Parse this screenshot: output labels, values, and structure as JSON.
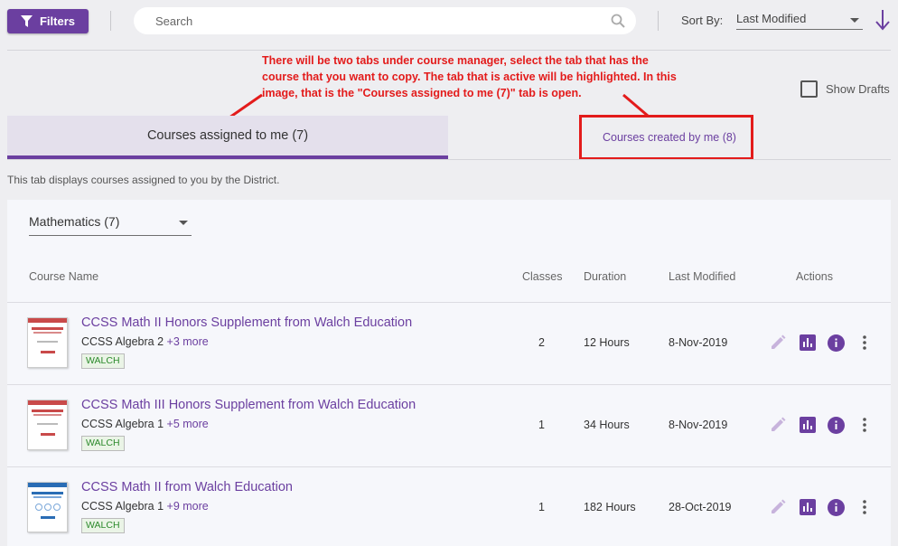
{
  "toolbar": {
    "filters_label": "Filters",
    "search_placeholder": "Search",
    "sort_by_label": "Sort By:",
    "sort_value": "Last Modified"
  },
  "annotation": {
    "text": "There will be two tabs under course manager, select the tab that has the course that you want to copy. The tab that is active will be highlighted. In this image, that is the \"Courses assigned to me (7)\" tab is open."
  },
  "show_drafts_label": "Show Drafts",
  "tabs": {
    "assigned_label": "Courses assigned to me (7)",
    "created_label": "Courses created by me (8)"
  },
  "tab_info": "This tab displays courses assigned to you by the District.",
  "subject_filter": "Mathematics (7)",
  "table": {
    "headers": {
      "course_name": "Course Name",
      "classes": "Classes",
      "duration": "Duration",
      "last_modified": "Last Modified",
      "actions": "Actions"
    },
    "rows": [
      {
        "name": "CCSS Math II Honors Supplement from Walch Education",
        "subject": "CCSS Algebra 2",
        "more": "+3 more",
        "tag": "WALCH",
        "classes": "2",
        "duration": "12 Hours",
        "last_modified": "8-Nov-2019"
      },
      {
        "name": "CCSS Math III Honors Supplement from Walch Education",
        "subject": "CCSS Algebra 1",
        "more": "+5 more",
        "tag": "WALCH",
        "classes": "1",
        "duration": "34 Hours",
        "last_modified": "8-Nov-2019"
      },
      {
        "name": "CCSS Math II from Walch Education",
        "subject": "CCSS Algebra 1",
        "more": "+9 more",
        "tag": "WALCH",
        "classes": "1",
        "duration": "182 Hours",
        "last_modified": "28-Oct-2019"
      }
    ]
  },
  "colors": {
    "accent": "#6b3fa0",
    "annotation": "#e31b1b",
    "tag_text": "#2c8a2c"
  },
  "icons": [
    "filter-icon",
    "search-icon",
    "sort-arrow-icon",
    "edit-icon",
    "report-icon",
    "info-icon",
    "more-vert-icon"
  ]
}
